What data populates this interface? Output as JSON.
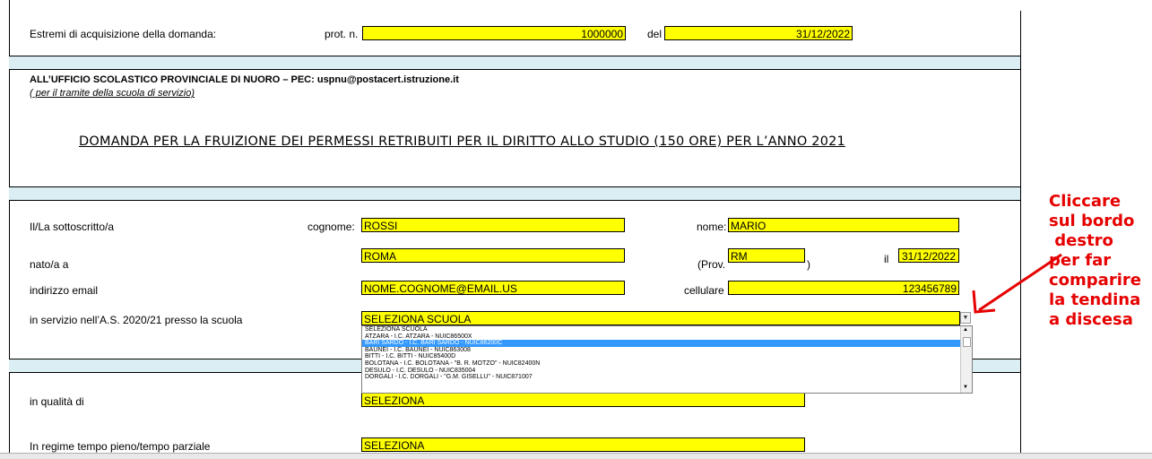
{
  "acquisition": {
    "label": "Estremi di acquisizione della domanda:",
    "prot_label": "prot. n.",
    "prot_value": "1000000",
    "del_label": "del",
    "del_value": "31/12/2022"
  },
  "office": {
    "line1": "ALL’UFFICIO SCOLASTICO PROVINCIALE DI NUORO – PEC: uspnu@postacert.istruzione.it",
    "line2": "( per il tramite della scuola di servizio)"
  },
  "title": "DOMANDA PER LA FRUIZIONE DEI PERMESSI RETRIBUITI PER IL DIRITTO ALLO STUDIO (150 ORE) PER L’ANNO 2021",
  "person": {
    "sottoscritto_label": "Il/La sottoscritto/a",
    "cognome_label": "cognome:",
    "cognome_value": "ROSSI",
    "nome_label": "nome:",
    "nome_value": "MARIO",
    "nato_label": "nato/a  a",
    "nato_value": "ROMA",
    "prov_label": "(Prov.",
    "prov_value": "RM",
    "prov_close": ")",
    "il_label": "il",
    "il_value": "31/12/2022",
    "email_label": "indirizzo email",
    "email_value": "NOME.COGNOME@EMAIL.US",
    "cellulare_label": "cellulare",
    "cellulare_value": "123456789",
    "servizio_label": "in servizio nell’A.S. 2020/21 presso la scuola",
    "scuola_value": "SELEZIONA SCUOLA"
  },
  "dropdown": {
    "options": [
      "SELEZIONA SCUOLA",
      "ATZARA - I.C. ATZARA - NUIC86500X",
      "BARI SARDO - I.C. BARI SARDO - NUIC86200C",
      "BAUNEI - I.C. BAUNEI - NUIC863008",
      "BITTI - I.C. BITTI - NUIC85400D",
      "BOLOTANA - I.C. BOLOTANA - \"B. R. MOTZO\" - NUIC82400N",
      "DESULO - I.C. DESULO - NUIC835004",
      "DORGALI - I.C. DORGALI - \"G.M. GISELLU\" - NUIC871007"
    ],
    "selected_index": 2
  },
  "qualita": {
    "label": "in qualità di",
    "value": "SELEZIONA"
  },
  "regime": {
    "label": "In regime tempo pieno/tempo parziale",
    "value": "SELEZIONA"
  },
  "annotation": {
    "lines": [
      "Cliccare",
      "sul bordo",
      " destro",
      "per far",
      "comparire",
      "la tendina",
      "a discesa"
    ],
    "color": "#e60000"
  },
  "colors": {
    "field": "#ffff00",
    "band": "#daeef3",
    "selection": "#3399ff"
  }
}
